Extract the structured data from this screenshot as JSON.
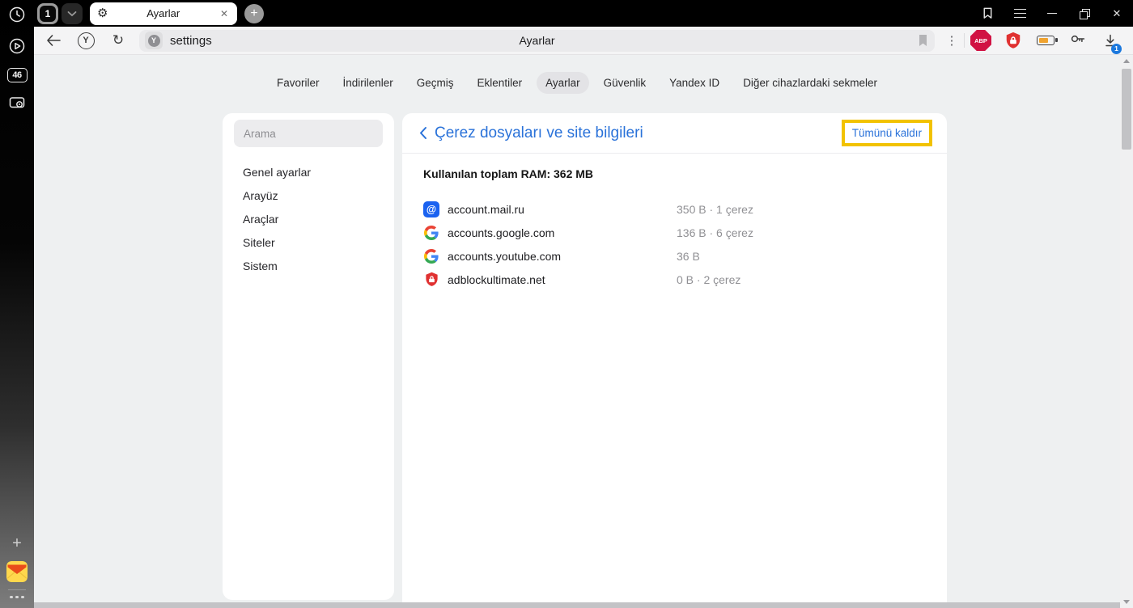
{
  "rail": {
    "tab_count_badge": "46"
  },
  "tab_strip": {
    "counter": "1",
    "tab_title": "Ayarlar"
  },
  "toolbar": {
    "url": "settings",
    "page_title": "Ayarlar",
    "abp_label": "ABP",
    "download_badge": "1"
  },
  "nav_tabs": [
    {
      "label": "Favoriler",
      "active": false
    },
    {
      "label": "İndirilenler",
      "active": false
    },
    {
      "label": "Geçmiş",
      "active": false
    },
    {
      "label": "Eklentiler",
      "active": false
    },
    {
      "label": "Ayarlar",
      "active": true
    },
    {
      "label": "Güvenlik",
      "active": false
    },
    {
      "label": "Yandex ID",
      "active": false
    },
    {
      "label": "Diğer cihazlardaki sekmeler",
      "active": false
    }
  ],
  "settings_nav": {
    "search_placeholder": "Arama",
    "items": [
      "Genel ayarlar",
      "Arayüz",
      "Araçlar",
      "Siteler",
      "Sistem"
    ]
  },
  "cookies_panel": {
    "title": "Çerez dosyaları ve site bilgileri",
    "remove_all_label": "Tümünü kaldır",
    "ram_text": "Kullanılan toplam RAM: 362 MB",
    "sites": [
      {
        "domain": "account.mail.ru",
        "info": "350 B · 1 çerez",
        "icon": "mailru"
      },
      {
        "domain": "accounts.google.com",
        "info": "136 B · 6 çerez",
        "icon": "google"
      },
      {
        "domain": "accounts.youtube.com",
        "info": "36 B",
        "icon": "google"
      },
      {
        "domain": "adblockultimate.net",
        "info": "0 B · 2 çerez",
        "icon": "shield"
      }
    ]
  },
  "colors": {
    "accent_blue": "#2a72d9",
    "highlight_yellow": "#f2c200",
    "abp_red": "#d11243",
    "shield_red": "#e03131"
  }
}
